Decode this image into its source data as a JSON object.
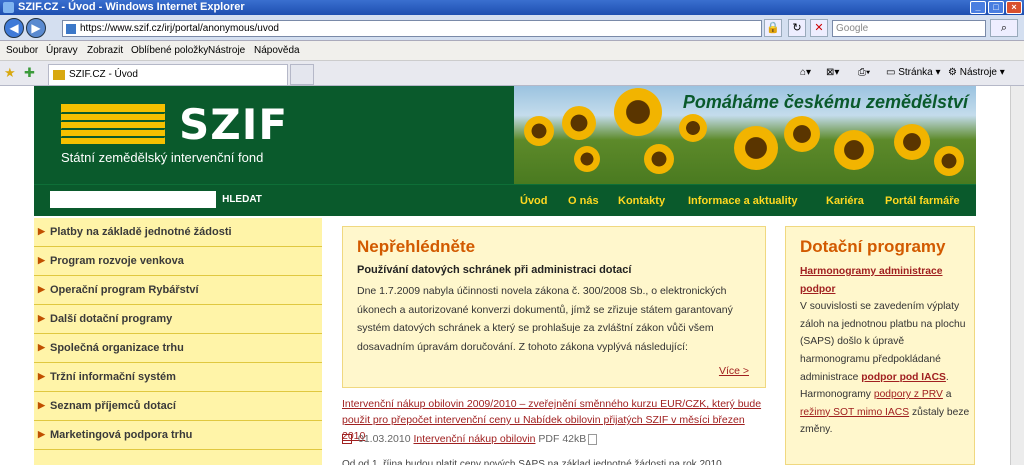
{
  "window": {
    "title": "SZIF.CZ - Úvod - Windows Internet Explorer"
  },
  "browser": {
    "url": "https://www.szif.cz/irj/portal/anonymous/uvod",
    "search_placeholder": "Google",
    "menu": [
      "Soubor",
      "Úpravy",
      "Zobrazit",
      "Oblíbené položky",
      "Nástroje",
      "Nápověda"
    ],
    "tab_title": "SZIF.CZ - Úvod",
    "cmd_page": "Stránka",
    "cmd_tools": "Nástroje"
  },
  "site": {
    "logo": "SZIF",
    "logo_sub": "Státní zemědělský intervenční fond",
    "slogan": "Pomáháme českému zemědělství",
    "search_button": "HLEDAT",
    "nav": [
      "Úvod",
      "O nás",
      "Kontakty",
      "Informace a aktuality",
      "Kariéra",
      "Portál farmáře"
    ],
    "sidebar": [
      "Platby na základě jednotné žádosti",
      "Program rozvoje venkova",
      "Operační program Rybářství",
      "Další dotační programy",
      "Společná organizace trhu",
      "Tržní informační systém",
      "Seznam příjemců dotací",
      "Marketingová podpora trhu"
    ],
    "notice": {
      "heading": "Nepřehlédněte",
      "subheading": "Používání datových schránek při administraci dotací",
      "body": "Dne 1.7.2009 nabyla účinnosti novela zákona č. 300/2008 Sb., o elektronických úkonech a autorizované konverzi dokumentů, jímž se zřizuje státem garantovaný systém datových schránek a který se prohlašuje za zvláštní zákon vůči všem dosavadním úpravám doručování. Z tohoto zákona vyplývá následující:",
      "more": "Více >"
    },
    "news": [
      {
        "title": "Intervenční nákup obilovin 2009/2010 – zveřejnění směnného kurzu EUR/CZK, který bude použit pro přepočet intervenční ceny u Nabídek obilovin přijatých SZIF v měsíci březen 2010",
        "date": "01.03.2010",
        "file": "Intervenční nákup obilovin",
        "file_info": "PDF 42kB"
      }
    ],
    "next_line": "Od od 1. října budou platit ceny nových SAPS na základ jednotné žádosti na rok 2010",
    "programs": {
      "heading": "Dotační programy",
      "link_main": "Harmonogramy administrace podpor",
      "text1": "V souvislosti se zavedením výplaty záloh na jednotnou platbu na plochu (SAPS) došlo k úpravě harmonogramu předpokládané administrace",
      "link2": "podpor pod IACS",
      "text2": ". Harmonogramy",
      "link3": "podpory z PRV",
      "text3": "a",
      "link4": "režimy SOT mimo IACS",
      "text4": "zůstaly beze změny."
    }
  }
}
